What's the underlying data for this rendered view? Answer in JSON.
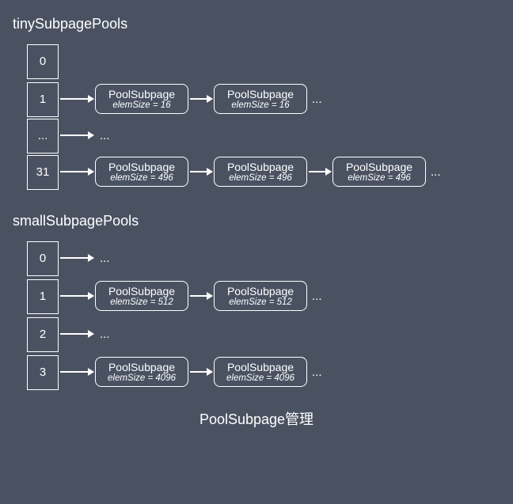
{
  "sections": [
    {
      "title": "tinySubpagePools",
      "rows": [
        {
          "index": "0",
          "nodes": []
        },
        {
          "index": "1",
          "nodes": [
            {
              "title": "PoolSubpage",
              "sub": "elemSize = 16"
            },
            {
              "title": "PoolSubpage",
              "sub": "elemSize = 16"
            }
          ],
          "trailing": "..."
        },
        {
          "index": "...",
          "arrowToEllipsis": true,
          "ellipsis": "..."
        },
        {
          "index": "31",
          "nodes": [
            {
              "title": "PoolSubpage",
              "sub": "elemSize = 496"
            },
            {
              "title": "PoolSubpage",
              "sub": "elemSize = 496"
            },
            {
              "title": "PoolSubpage",
              "sub": "elemSize = 496"
            }
          ],
          "trailing": "..."
        }
      ]
    },
    {
      "title": "smallSubpagePools",
      "rows": [
        {
          "index": "0",
          "arrowToEllipsis": true,
          "ellipsis": "..."
        },
        {
          "index": "1",
          "nodes": [
            {
              "title": "PoolSubpage",
              "sub": "elemSize = 512"
            },
            {
              "title": "PoolSubpage",
              "sub": "elemSize = 512"
            }
          ],
          "trailing": "..."
        },
        {
          "index": "2",
          "arrowToEllipsis": true,
          "ellipsis": "..."
        },
        {
          "index": "3",
          "nodes": [
            {
              "title": "PoolSubpage",
              "sub": "elemSize = 4096"
            },
            {
              "title": "PoolSubpage",
              "sub": "elemSize = 4096"
            }
          ],
          "trailing": "..."
        }
      ]
    }
  ],
  "caption": "PoolSubpage管理"
}
